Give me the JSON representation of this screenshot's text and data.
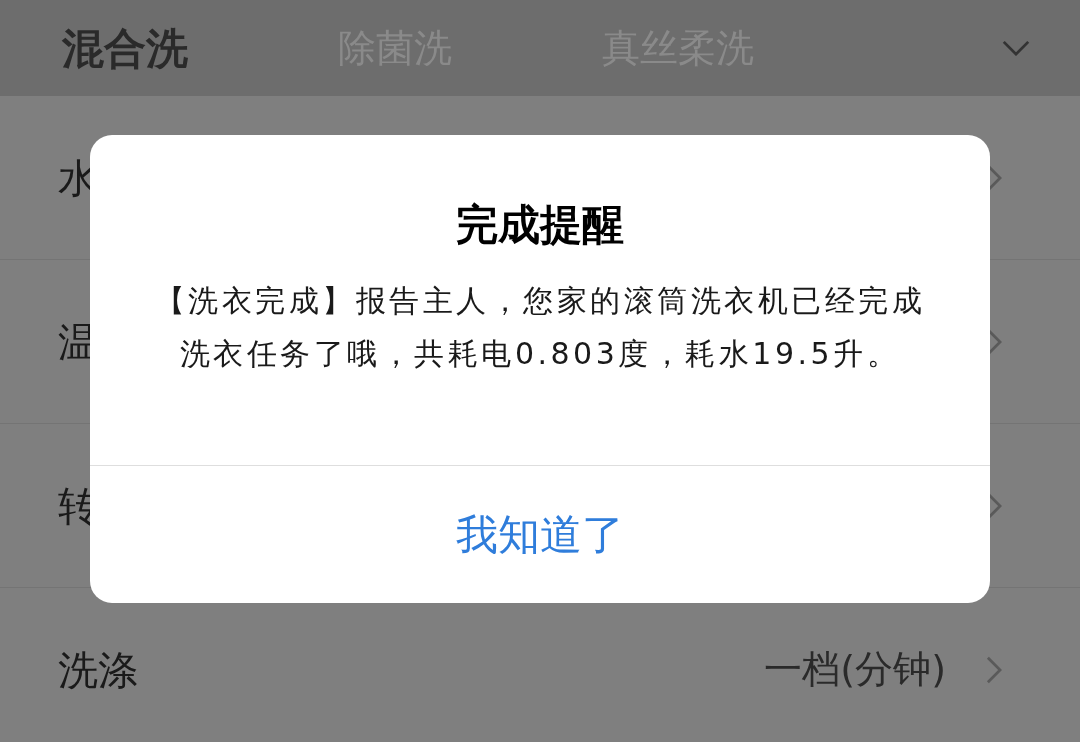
{
  "tabs": [
    {
      "label": "混合洗",
      "selected": true
    },
    {
      "label": "除菌洗",
      "selected": false
    },
    {
      "label": "真丝柔洗",
      "selected": false
    }
  ],
  "settings": [
    {
      "label": "水"
    },
    {
      "label": "温"
    },
    {
      "label": "转"
    },
    {
      "label": "洗涤",
      "value": "一档(分钟)"
    }
  ],
  "dialog": {
    "title": "完成提醒",
    "message": "【洗衣完成】报告主人，您家的滚筒洗衣机已经完成洗衣任务了哦，共耗电0.803度，耗水19.5升。",
    "button": "我知道了"
  }
}
